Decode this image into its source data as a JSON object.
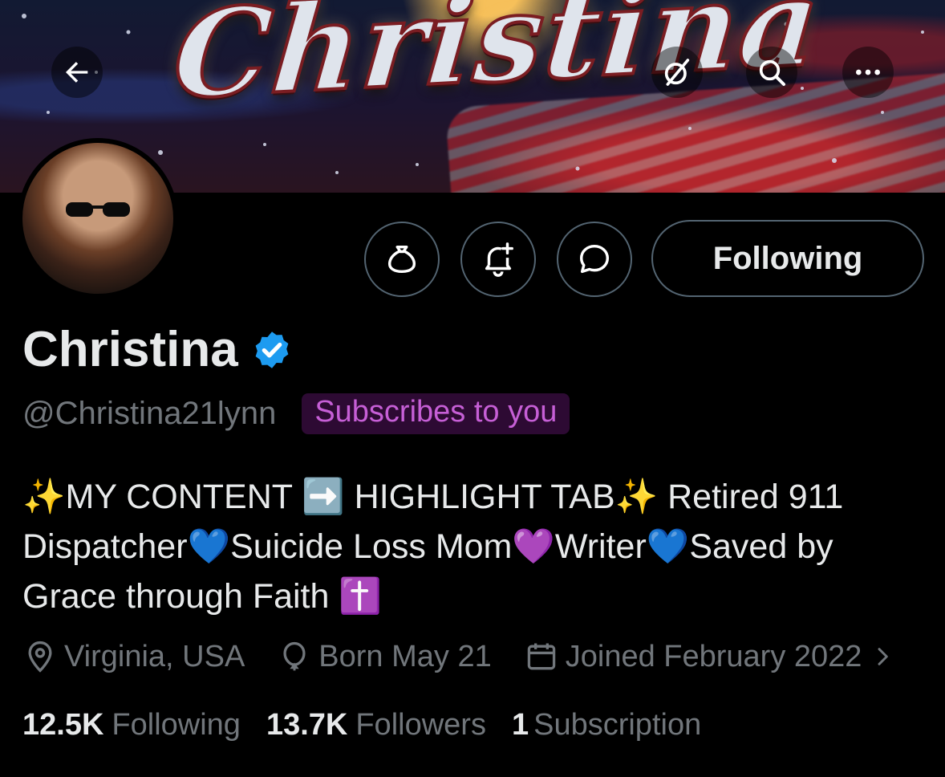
{
  "banner": {
    "title": "Christina"
  },
  "header": {
    "back_icon": "arrow-left-icon",
    "grok_icon": "grok-icon",
    "search_icon": "search-icon",
    "more_icon": "more-horizontal-icon"
  },
  "actions": {
    "tip_icon": "money-bag-icon",
    "notify_icon": "bell-plus-icon",
    "message_icon": "message-bubble-icon",
    "follow_label": "Following"
  },
  "profile": {
    "name": "Christina",
    "handle": "@Christina21lynn",
    "subscribes_badge": "Subscribes to you",
    "verified_color": "#1d9bf0",
    "bio": "✨MY CONTENT ➡️ HIGHLIGHT TAB✨ Retired 911 Dispatcher💙Suicide Loss Mom💜Writer💙Saved by Grace through Faith ✝️",
    "location": "Virginia, USA",
    "birthday": "Born May 21",
    "joined": "Joined February 2022"
  },
  "stats": {
    "following_count": "12.5K",
    "following_label": "Following",
    "followers_count": "13.7K",
    "followers_label": "Followers",
    "subscription_count": "1",
    "subscription_label": "Subscription"
  }
}
